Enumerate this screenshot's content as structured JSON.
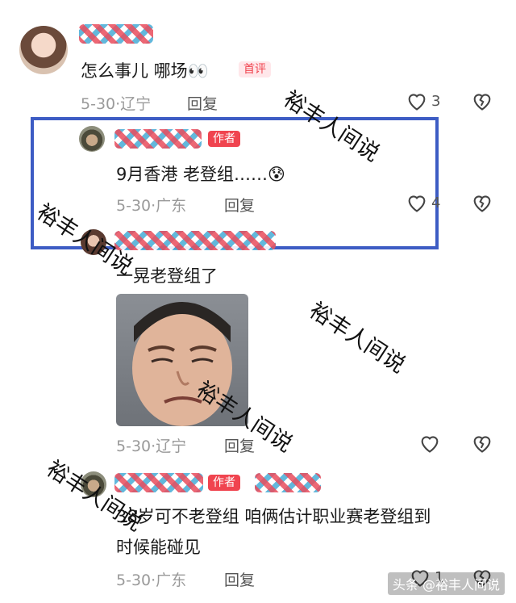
{
  "comments": [
    {
      "text": "怎么事儿 哪场",
      "emoji": "👀",
      "badge": "首评",
      "date": "5-30",
      "location": "辽宁",
      "reply_label": "回复",
      "likes": "3"
    },
    {
      "text": "9月香港 老登组……",
      "emoji": "😰",
      "badge": "作者",
      "date": "5-30",
      "location": "广东",
      "reply_label": "回复",
      "likes": "4"
    },
    {
      "text": "一晃老登组了",
      "date": "5-30",
      "location": "辽宁",
      "reply_label": "回复"
    },
    {
      "text_line1": "38岁可不老登组 咱俩估计职业赛老登组到",
      "text_line2": "时候能碰见",
      "badge": "作者",
      "date": "5-30",
      "location": "广东",
      "reply_label": "回复",
      "likes": "1"
    }
  ],
  "watermark": "裕丰人间说",
  "footer": "头条 @裕丰人间说",
  "colors": {
    "author_badge": "#f0444f",
    "highlight_border": "#3d5cc4"
  }
}
